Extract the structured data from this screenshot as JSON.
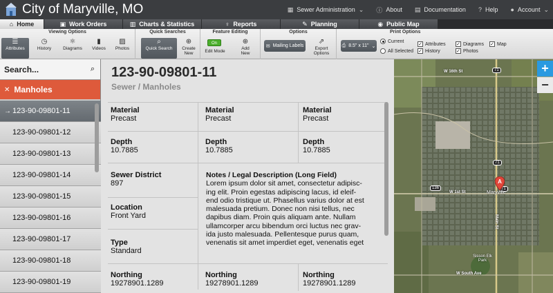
{
  "header": {
    "title": "City of Maryville, MO",
    "nav": [
      {
        "icon": "grid-icon",
        "label": "Sewer Administration",
        "dropdown": true
      },
      {
        "icon": "info-icon",
        "label": "About"
      },
      {
        "icon": "document-icon",
        "label": "Documentation"
      },
      {
        "icon": "help-icon",
        "label": "Help"
      },
      {
        "icon": "user-icon",
        "label": "Account",
        "dropdown": true
      }
    ]
  },
  "tabs": [
    {
      "icon": "home-icon",
      "label": "Home",
      "active": true
    },
    {
      "icon": "clipboard-icon",
      "label": "Work Orders"
    },
    {
      "icon": "bar-chart-icon",
      "label": "Charts & Statistics"
    },
    {
      "icon": "lightbulb-icon",
      "label": "Reports"
    },
    {
      "icon": "pencil-icon",
      "label": "Planning"
    },
    {
      "icon": "car-icon",
      "label": "Public Map"
    }
  ],
  "ribbon": {
    "viewing_options": {
      "title": "Viewing Options",
      "buttons": [
        "Attributes",
        "History",
        "Diagrams",
        "Videos",
        "Photos"
      ]
    },
    "quick_searches": {
      "title": "Quick Searches",
      "quick_search": "Quick Search",
      "create_new_1": "Create",
      "create_new_2": "New"
    },
    "feature_editing": {
      "title": "Feature Editing",
      "toggle": "On",
      "edit_mode": "Edit Mode",
      "add_new_1": "Add",
      "add_new_2": "New"
    },
    "options": {
      "title": "Options",
      "mailing_labels": "Mailing Labels",
      "export_1": "Export",
      "export_2": "Options"
    },
    "print_options": {
      "title": "Print Options",
      "paper": "8.5\" x 11\"",
      "current": "Current",
      "all_selected": "All Selected",
      "attributes": "Attributes",
      "history": "History",
      "diagrams": "Diagrams",
      "photos": "Photos",
      "map": "Map"
    }
  },
  "sidebar": {
    "search_placeholder": "Search...",
    "layer": "Manholes",
    "items": [
      "123-90-09801-11",
      "123-90-09801-12",
      "123-90-09801-13",
      "123-90-09801-14",
      "123-90-09801-15",
      "123-90-09801-16",
      "123-90-09801-17",
      "123-90-09801-18",
      "123-90-09801-19"
    ]
  },
  "record": {
    "id": "123-90-09801-11",
    "subtitle": "Sewer / Manholes",
    "material_label": "Material",
    "material_value": "Precast",
    "depth_label": "Depth",
    "depth_value": "10.7885",
    "district_label": "Sewer District",
    "district_value": "897",
    "location_label": "Location",
    "location_value": "Front Yard",
    "type_label": "Type",
    "type_value": "Standard",
    "northing_label": "Northing",
    "northing_value": "19278901.1289",
    "notes_label": "Notes / Legal Description (Long Field)",
    "notes_lines": [
      "Lorem ipsum dolor sit amet, consectetur adipisc-",
      "ing elit. Proin egestas adipiscing lacus, id eleif-",
      "end odio tristique ut. Phasellus varius dolor at est",
      "malesuada pretium. Donec non nisi tellus, nec",
      "dapibus diam. Proin quis aliquam ante. Nullam",
      "ullamcorper arcu bibendum orci luctus nec grav-",
      "ida justo malesuada. Pellentesque purus quam,",
      "venenatis sit amet imperdiet eget, venenatis eget"
    ]
  },
  "map": {
    "zoom_in": "+",
    "zoom_out": "−",
    "pin_label": "A",
    "town_label": "Maryville",
    "park_label": "Sisson Elk Park",
    "roads": [
      "W 16th St",
      "W 1st St",
      "W South Ave",
      "Main St"
    ],
    "shields": [
      "71",
      "71",
      "71",
      "136"
    ]
  }
}
